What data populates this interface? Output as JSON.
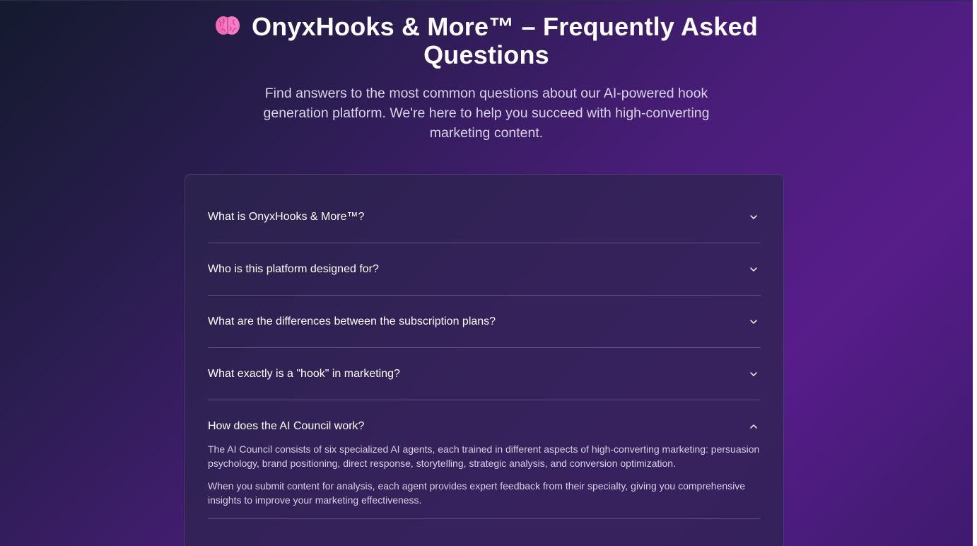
{
  "header": {
    "title": "OnyxHooks & More™ – Frequently Asked Questions",
    "title_icon": "brain-icon",
    "subtitle": "Find answers to the most common questions about our AI-powered hook generation platform. We're here to help you succeed with high-converting marketing content."
  },
  "faq": {
    "items": [
      {
        "question": "What is OnyxHooks & More™?",
        "expanded": false
      },
      {
        "question": "Who is this platform designed for?",
        "expanded": false
      },
      {
        "question": "What are the differences between the subscription plans?",
        "expanded": false
      },
      {
        "question": "What exactly is a \"hook\" in marketing?",
        "expanded": false
      },
      {
        "question": "How does the AI Council work?",
        "expanded": true,
        "answer": [
          "The AI Council consists of six specialized AI agents, each trained in different aspects of high-converting marketing: persuasion psychology, brand positioning, direct response, storytelling, strategic analysis, and conversion optimization.",
          "When you submit content for analysis, each agent provides expert feedback from their specialty, giving you comprehensive insights to improve your marketing effectiveness."
        ]
      }
    ]
  },
  "colors": {
    "background_start": "#141a2e",
    "background_end": "#571d8a",
    "card": "#2c244e",
    "text": "#ffffff",
    "muted_text": "#d9d3e8"
  }
}
